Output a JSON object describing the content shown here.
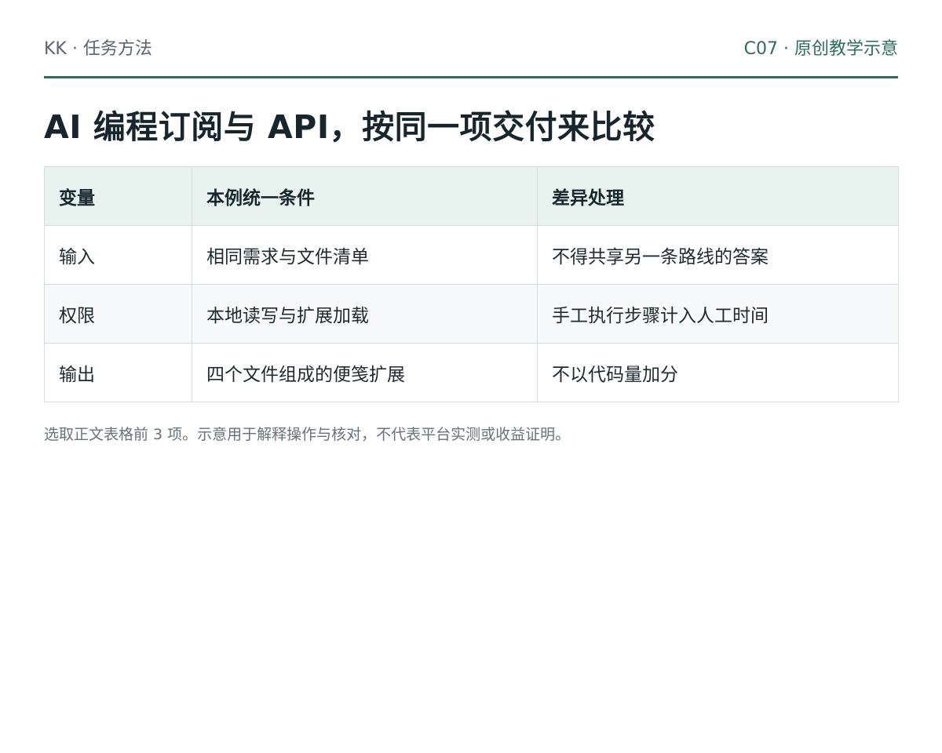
{
  "header": {
    "left": "KK · 任务方法",
    "right": "C07 · 原创教学示意"
  },
  "title": "AI 编程订阅与 API，按同一项交付来比较",
  "table": {
    "headers": [
      "变量",
      "本例统一条件",
      "差异处理"
    ],
    "rows": [
      [
        "输入",
        "相同需求与文件清单",
        "不得共享另一条路线的答案"
      ],
      [
        "权限",
        "本地读写与扩展加载",
        "手工执行步骤计入人工时间"
      ],
      [
        "输出",
        "四个文件组成的便笺扩展",
        "不以代码量加分"
      ]
    ]
  },
  "note": "选取正文表格前 3 项。示意用于解释操作与核对，不代表平台实测或收益证明。",
  "colors": {
    "accent": "#2c6e5e",
    "header_bg": "#e8f3ef",
    "border": "#d6dcdf"
  }
}
